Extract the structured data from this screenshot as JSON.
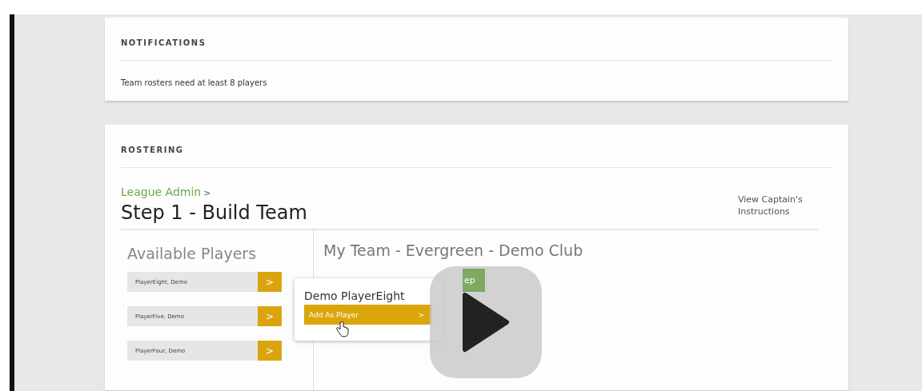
{
  "notifications": {
    "title": "NOTIFICATIONS",
    "message": "Team rosters need at least 8 players"
  },
  "rostering": {
    "title": "ROSTERING",
    "breadcrumb": "League Admin",
    "breadcrumb_separator": ">",
    "heading": "Step 1 - Build Team",
    "instructions_link": "View Captain's Instructions",
    "available_title": "Available Players",
    "players": [
      {
        "name": "PlayerEight, Demo",
        "action": ">"
      },
      {
        "name": "PlayerFive, Demo",
        "action": ">"
      },
      {
        "name": "PlayerFour, Demo",
        "action": ">"
      }
    ],
    "team_title": "My Team - Evergreen - Demo Club",
    "team_button": "ep",
    "popover": {
      "name": "Demo PlayerEight",
      "action": "Add As Player",
      "action_arrow": ">"
    }
  }
}
